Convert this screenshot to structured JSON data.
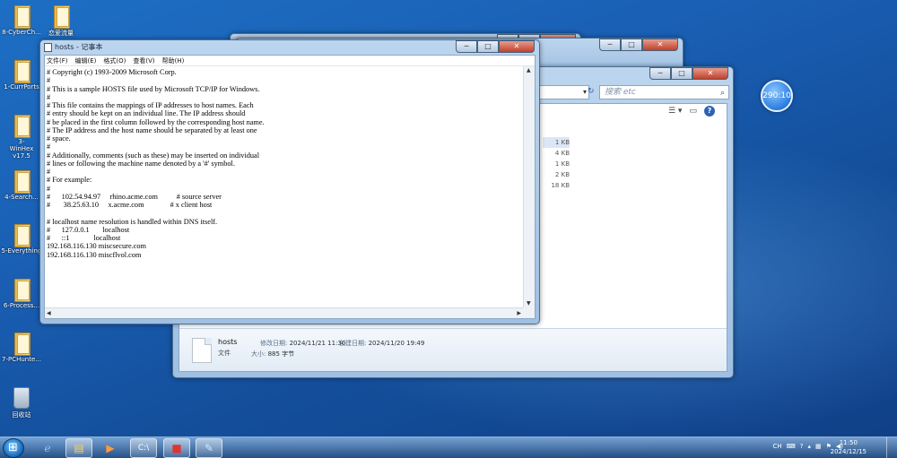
{
  "desktop": {
    "icons": [
      {
        "label": "8-CyberCh..."
      },
      {
        "label": "恋爱流量"
      },
      {
        "label": "1-CurrPorts"
      },
      {
        "label": "3-WinHex v17.5"
      },
      {
        "label": "4-Search..."
      },
      {
        "label": "5-Everything"
      },
      {
        "label": "6-Process..."
      },
      {
        "label": "7-PCHunte..."
      },
      {
        "label": "回收站"
      }
    ],
    "gadget_text": "290:10"
  },
  "explorer": {
    "search_placeholder": "搜索 etc",
    "file_sizes": [
      "1 KB",
      "4 KB",
      "1 KB",
      "2 KB",
      "18 KB"
    ],
    "details": {
      "name": "hosts",
      "type": "文件",
      "modified_label": "修改日期:",
      "modified_value": "2024/11/21 11:30",
      "created_label": "创建日期:",
      "created_value": "2024/11/20 19:49",
      "size_label": "大小:",
      "size_value": "885 字节"
    }
  },
  "notepad": {
    "title": "hosts - 记事本",
    "menu": [
      "文件(F)",
      "编辑(E)",
      "格式(O)",
      "查看(V)",
      "帮助(H)"
    ],
    "content": "# Copyright (c) 1993-2009 Microsoft Corp.\n#\n# This is a sample HOSTS file used by Microsoft TCP/IP for Windows.\n#\n# This file contains the mappings of IP addresses to host names. Each\n# entry should be kept on an individual line. The IP address should\n# be placed in the first column followed by the corresponding host name.\n# The IP address and the host name should be separated by at least one\n# space.\n#\n# Additionally, comments (such as these) may be inserted on individual\n# lines or following the machine name denoted by a '#' symbol.\n#\n# For example:\n#\n#      102.54.94.97     rhino.acme.com          # source server\n#       38.25.63.10     x.acme.com              # x client host\n\n# localhost name resolution is handled within DNS itself.\n#\t127.0.0.1       localhost\n#\t::1             localhost\n192.168.116.130 miscsecure.com\n192.168.116.130 miscflvol.com"
  },
  "taskbar": {
    "lang": "CH",
    "time": "11:50",
    "date": "2024/12/15"
  }
}
